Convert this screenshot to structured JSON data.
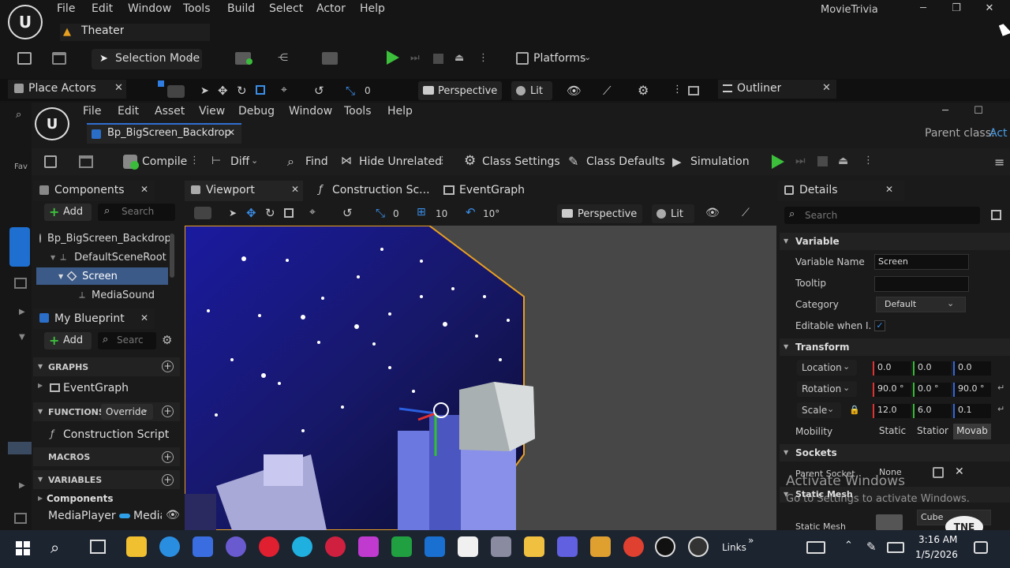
{
  "main": {
    "menu": [
      "File",
      "Edit",
      "Window",
      "Tools",
      "Build",
      "Select",
      "Actor",
      "Help"
    ],
    "level_tab": "Theater",
    "project": "MovieTrivia",
    "mode_label": "Selection Mode",
    "platforms_label": "Platforms"
  },
  "viewport_bar": {
    "place_actors": "Place Actors",
    "angle": "0",
    "perspective": "Perspective",
    "lit": "Lit",
    "outliner": "Outliner"
  },
  "bp": {
    "menu": [
      "File",
      "Edit",
      "Asset",
      "View",
      "Debug",
      "Window",
      "Tools",
      "Help"
    ],
    "tab_title": "Bp_BigScreen_Backdrop",
    "parent_class_label": "Parent class:",
    "parent_class_value": "Act",
    "toolbar": {
      "compile": "Compile",
      "diff": "Diff",
      "find": "Find",
      "hide_unrelated": "Hide Unrelated",
      "class_settings": "Class Settings",
      "class_defaults": "Class Defaults",
      "simulation": "Simulation"
    },
    "tabs": {
      "components": "Components",
      "viewport": "Viewport",
      "construction": "Construction Sc...",
      "eventgraph": "EventGraph",
      "details": "Details"
    }
  },
  "components": {
    "add_label": "Add",
    "search_placeholder": "Search",
    "tree": [
      "Bp_BigScreen_Backdrop",
      "DefaultSceneRoot",
      "Screen",
      "MediaSound"
    ]
  },
  "my_blueprint": {
    "title": "My Blueprint",
    "add_label": "Add",
    "search_placeholder": "Searc",
    "graphs_header": "GRAPHS",
    "event_graph": "EventGraph",
    "functions_header": "FUNCTIONS (",
    "override_label": "Override",
    "construction_script": "Construction Script",
    "macros_header": "MACROS",
    "variables_header": "VARIABLES",
    "components_group": "Components",
    "var_name": "MediaPlayer",
    "var_type": "Media"
  },
  "vp_toolbar": {
    "grid": "0",
    "snap": "10",
    "rot": "10°",
    "perspective": "Perspective",
    "lit": "Lit"
  },
  "details": {
    "search_placeholder": "Search",
    "variable_header": "Variable",
    "variable_name_label": "Variable Name",
    "variable_name_value": "Screen",
    "tooltip_label": "Tooltip",
    "category_label": "Category",
    "category_value": "Default",
    "editable_label": "Editable when I...",
    "transform_header": "Transform",
    "location_label": "Location",
    "location": [
      "0.0",
      "0.0",
      "0.0"
    ],
    "rotation_label": "Rotation",
    "rotation": [
      "90.0 °",
      "0.0 °",
      "90.0 °"
    ],
    "scale_label": "Scale",
    "scale": [
      "12.0",
      "6.0",
      "0.1"
    ],
    "mobility_label": "Mobility",
    "mobility": [
      "Static",
      "Statior",
      "Movab"
    ],
    "sockets_header": "Sockets",
    "parent_socket_label": "Parent Socket",
    "parent_socket_value": "None",
    "static_mesh_header": "Static Mesh",
    "static_mesh_label": "Static Mesh",
    "static_mesh_value": "Cube"
  },
  "watermark": {
    "line1": "Activate Windows",
    "line2": "Go to Settings to activate Windows."
  },
  "taskbar": {
    "links": "Links",
    "time": "3:16 AM",
    "date": "1/5/2026"
  }
}
